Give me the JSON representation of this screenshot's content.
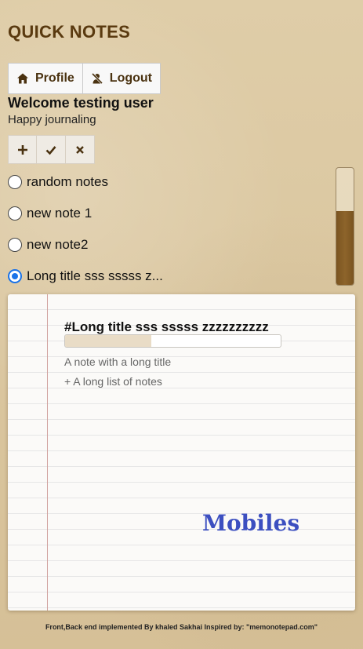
{
  "app": {
    "title": "QUICK NOTES"
  },
  "header": {
    "profile_label": "Profile",
    "logout_label": "Logout",
    "welcome": "Welcome testing user",
    "subtitle": "Happy journaling"
  },
  "toolbar": {
    "icons": [
      "plus-icon",
      "check-icon",
      "close-icon"
    ]
  },
  "notes": [
    {
      "label": "random notes",
      "selected": false
    },
    {
      "label": "new note 1",
      "selected": false
    },
    {
      "label": "new note2",
      "selected": false
    },
    {
      "label": "Long title sss sssss z...",
      "selected": true
    }
  ],
  "scrollbar": {
    "level": 0.63
  },
  "editor": {
    "title": "#Long title sss sssss zzzzzzzzzz",
    "progress": 0.4,
    "lines": [
      "A note with a long title",
      "+ A long list of notes"
    ],
    "watermark": "Mobiles"
  },
  "footer": {
    "text": "Front,Back end implemented By khaled Sakhai Inspired by: \"memonotepad.com\""
  },
  "colors": {
    "brand": "#5a3a10",
    "accent": "#1a73e8",
    "bar": "#7a5420",
    "watermark": "#3c4fc0"
  }
}
